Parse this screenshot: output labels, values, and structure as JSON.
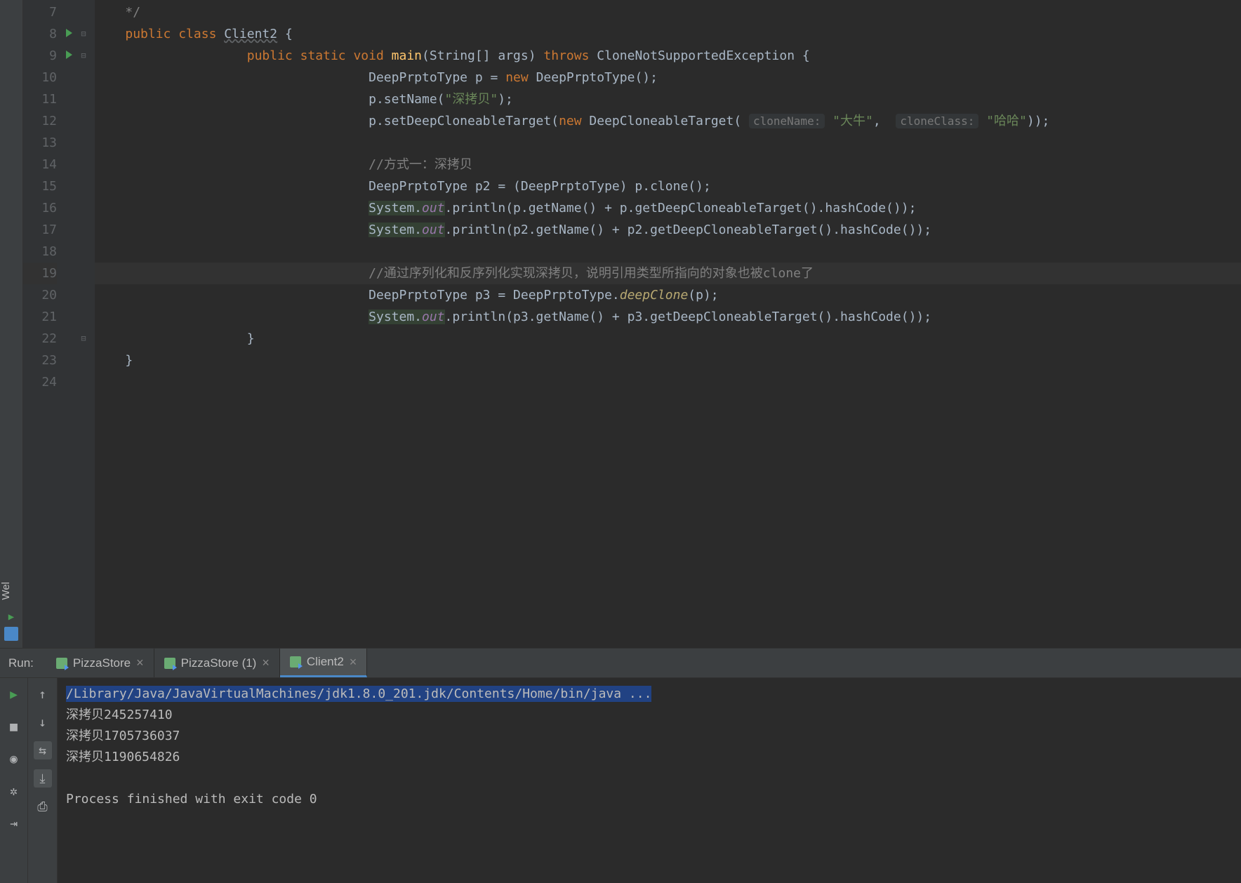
{
  "sidebar": {
    "label": "Wel",
    "tree_icon": "tree"
  },
  "gutter": {
    "lines": [
      7,
      8,
      9,
      10,
      11,
      12,
      13,
      14,
      15,
      16,
      17,
      18,
      19,
      20,
      21,
      22,
      23,
      24
    ],
    "run_markers": [
      8,
      9
    ],
    "cursor_line": 19
  },
  "fold": {
    "7": "*/",
    "8": "⊖",
    "9": "⊖",
    "22": "⊖"
  },
  "code": {
    "l7": {
      "indent": " ",
      "tokens": [
        {
          "t": "*/",
          "c": "comment"
        }
      ]
    },
    "l8": {
      "indent": " ",
      "tokens": [
        {
          "t": "public ",
          "c": "kw"
        },
        {
          "t": "class ",
          "c": "kw"
        },
        {
          "t": "Client2",
          "c": "class-underline"
        },
        {
          "t": " {"
        }
      ]
    },
    "l9": {
      "indent": "     ",
      "tokens": [
        {
          "t": "public ",
          "c": "kw"
        },
        {
          "t": "static ",
          "c": "kw"
        },
        {
          "t": "void ",
          "c": "kw"
        },
        {
          "t": "main",
          "c": "method"
        },
        {
          "t": "(String[] args) "
        },
        {
          "t": "throws ",
          "c": "kw"
        },
        {
          "t": "CloneNotSupportedException {"
        }
      ]
    },
    "l10": {
      "indent": "         ",
      "tokens": [
        {
          "t": "DeepPrptoType p = "
        },
        {
          "t": "new ",
          "c": "kw"
        },
        {
          "t": "DeepPrptoType();"
        }
      ]
    },
    "l11": {
      "indent": "         ",
      "tokens": [
        {
          "t": "p.setName("
        },
        {
          "t": "\"深拷贝\"",
          "c": "str"
        },
        {
          "t": ");"
        }
      ]
    },
    "l12": {
      "indent": "         ",
      "tokens": [
        {
          "t": "p.setDeepCloneableTarget("
        },
        {
          "t": "new ",
          "c": "kw"
        },
        {
          "t": "DeepCloneableTarget( "
        },
        {
          "t": "cloneName:",
          "c": "hint"
        },
        {
          "t": " "
        },
        {
          "t": "\"大牛\"",
          "c": "str"
        },
        {
          "t": ",  "
        },
        {
          "t": "cloneClass:",
          "c": "hint"
        },
        {
          "t": " "
        },
        {
          "t": "\"哈哈\"",
          "c": "str"
        },
        {
          "t": "));"
        }
      ]
    },
    "l13": {
      "indent": "",
      "tokens": []
    },
    "l14": {
      "indent": "         ",
      "tokens": [
        {
          "t": "//方式一：深拷贝",
          "c": "comment"
        }
      ]
    },
    "l15": {
      "indent": "         ",
      "tokens": [
        {
          "t": "DeepPrptoType p2 = (DeepPrptoType) p.clone();"
        }
      ]
    },
    "l16": {
      "indent": "         ",
      "tokens": [
        {
          "t": "System.",
          "bg": "highlighted-bg"
        },
        {
          "t": "out",
          "c": "static-field",
          "bg": "highlighted-bg"
        },
        {
          "t": ".println(p.getName() + p.getDeepCloneableTarget().hashCode());"
        }
      ]
    },
    "l17": {
      "indent": "         ",
      "tokens": [
        {
          "t": "System.",
          "bg": "highlighted-bg"
        },
        {
          "t": "out",
          "c": "static-field",
          "bg": "highlighted-bg"
        },
        {
          "t": ".println(p2.getName() + p2.getDeepCloneableTarget().hashCode());"
        }
      ]
    },
    "l18": {
      "indent": "",
      "tokens": []
    },
    "l19": {
      "indent": "         ",
      "tokens": [
        {
          "t": "//通过序列化和反序列化实现深拷贝，说明引用类型所指向的对象也被clone了",
          "c": "comment"
        }
      ]
    },
    "l20": {
      "indent": "         ",
      "tokens": [
        {
          "t": "DeepPrptoType p3 = DeepPrptoType."
        },
        {
          "t": "deepClone",
          "c": "static-call"
        },
        {
          "t": "(p);"
        }
      ]
    },
    "l21": {
      "indent": "         ",
      "tokens": [
        {
          "t": "System.",
          "bg": "highlighted-bg"
        },
        {
          "t": "out",
          "c": "static-field",
          "bg": "highlighted-bg"
        },
        {
          "t": ".println(p3.getName() + p3.getDeepCloneableTarget().hashCode());"
        }
      ]
    },
    "l22": {
      "indent": "     ",
      "tokens": [
        {
          "t": "}"
        }
      ]
    },
    "l23": {
      "indent": " ",
      "tokens": [
        {
          "t": "}"
        }
      ]
    },
    "l24": {
      "indent": "",
      "tokens": []
    }
  },
  "run": {
    "label": "Run:",
    "tabs": [
      {
        "name": "PizzaStore",
        "active": false
      },
      {
        "name": "PizzaStore (1)",
        "active": false
      },
      {
        "name": "Client2",
        "active": true
      }
    ],
    "toolbar_left": [
      "play",
      "arrow-up",
      "stop",
      "arrow-down",
      "camera",
      "wrap",
      "bug",
      "scroll",
      "exit",
      "print"
    ],
    "console_lines": [
      {
        "t": "/Library/Java/JavaVirtualMachines/jdk1.8.0_201.jdk/Contents/Home/bin/java ...",
        "hl": true
      },
      {
        "t": "深拷贝245257410"
      },
      {
        "t": "深拷贝1705736037"
      },
      {
        "t": "深拷贝1190654826"
      },
      {
        "t": ""
      },
      {
        "t": "Process finished with exit code 0"
      }
    ]
  }
}
